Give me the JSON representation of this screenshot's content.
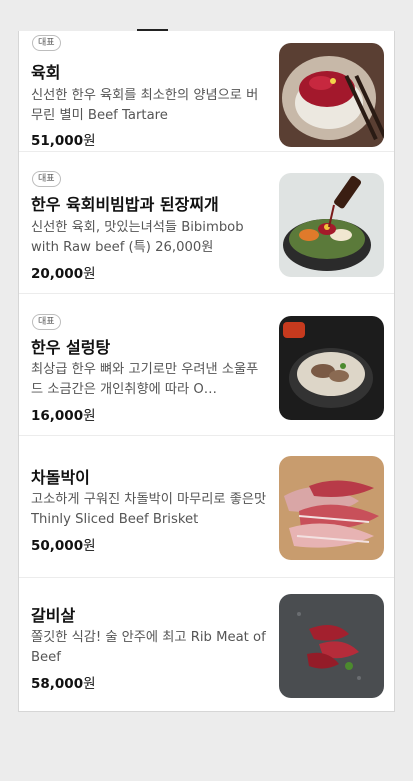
{
  "menu": {
    "items": [
      {
        "badge": "대표",
        "name": "육회",
        "description": "신선한 한우 육회를 최소한의 양념으로 버무린 별미 Beef Tartare",
        "price": "51,000",
        "currency": "원",
        "image": "beef-tartare-photo"
      },
      {
        "badge": "대표",
        "name": "한우 육회비빔밥과 된장찌개",
        "description": "신선한 육회, 맛있는녀석들 Bibimbob with Raw beef (특) 26,000원",
        "price": "20,000",
        "currency": "원",
        "image": "bibimbap-photo"
      },
      {
        "badge": "대표",
        "name": "한우 설렁탕",
        "description": "최상급 한우 뼈와 고기로만 우려낸 소울푸드 소금간은 개인취향에 따라 O…",
        "price": "16,000",
        "currency": "원",
        "image": "seolleongtang-photo"
      },
      {
        "badge": "",
        "name": "차돌박이",
        "description": "고소하게 구워진 차돌박이 마무리로 좋은맛 Thinly Sliced Beef Brisket",
        "price": "50,000",
        "currency": "원",
        "image": "beef-brisket-photo"
      },
      {
        "badge": "",
        "name": "갈비살",
        "description": "쫄깃한 식감! 술 안주에 최고 Rib Meat of Beef",
        "price": "58,000",
        "currency": "원",
        "image": "rib-meat-photo"
      }
    ]
  }
}
